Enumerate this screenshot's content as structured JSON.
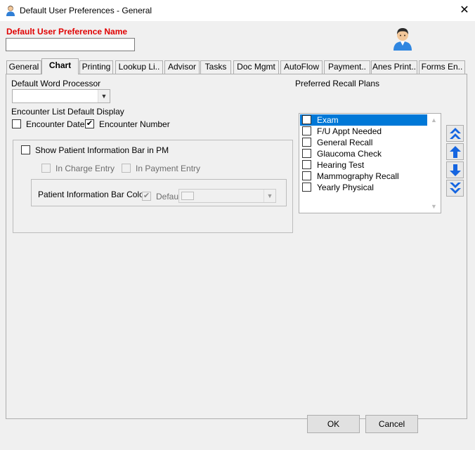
{
  "window": {
    "title": "Default User Preferences - General",
    "close_glyph": "✕"
  },
  "header": {
    "pref_name_label": "Default User Preference Name",
    "pref_name_value": ""
  },
  "tabs": [
    {
      "label": "General",
      "active": false
    },
    {
      "label": "Chart",
      "active": true
    },
    {
      "label": "Printing",
      "active": false
    },
    {
      "label": "Lookup Li..",
      "active": false
    },
    {
      "label": "Advisor",
      "active": false
    },
    {
      "label": "Tasks",
      "active": false
    },
    {
      "label": "Doc Mgmt",
      "active": false
    },
    {
      "label": "AutoFlow",
      "active": false
    },
    {
      "label": "Payment..",
      "active": false
    },
    {
      "label": "Anes Print..",
      "active": false
    },
    {
      "label": "Forms En..",
      "active": false
    }
  ],
  "chart_tab": {
    "word_processor_label": "Default Word Processor",
    "word_processor_value": "",
    "encounter_list_label": "Encounter List Default Display",
    "encounter_date": {
      "label": "Encounter Date",
      "checked": false
    },
    "encounter_number": {
      "label": "Encounter Number",
      "checked": true
    },
    "show_patient_info_bar": {
      "label": "Show Patient Information Bar in PM",
      "checked": false
    },
    "in_charge_entry": {
      "label": "In Charge Entry",
      "checked": false
    },
    "in_payment_entry": {
      "label": "In Payment Entry",
      "checked": false
    },
    "bar_color_label": "Patient Information Bar Color",
    "bar_color_default": {
      "label": "Default",
      "checked": true
    },
    "recall_plans_label": "Preferred Recall Plans",
    "recall_plans": [
      {
        "label": "Exam",
        "checked": false,
        "selected": true
      },
      {
        "label": "F/U Appt Needed",
        "checked": false,
        "selected": false
      },
      {
        "label": "General Recall",
        "checked": false,
        "selected": false
      },
      {
        "label": "Glaucoma Check",
        "checked": false,
        "selected": false
      },
      {
        "label": "Hearing Test",
        "checked": false,
        "selected": false
      },
      {
        "label": "Mammography Recall",
        "checked": false,
        "selected": false
      },
      {
        "label": "Yearly Physical",
        "checked": false,
        "selected": false
      }
    ]
  },
  "footer": {
    "ok_label": "OK",
    "cancel_label": "Cancel"
  },
  "colors": {
    "accent": "#0078d7",
    "name_label": "#e00000",
    "arrow_blue": "#1565e0"
  }
}
